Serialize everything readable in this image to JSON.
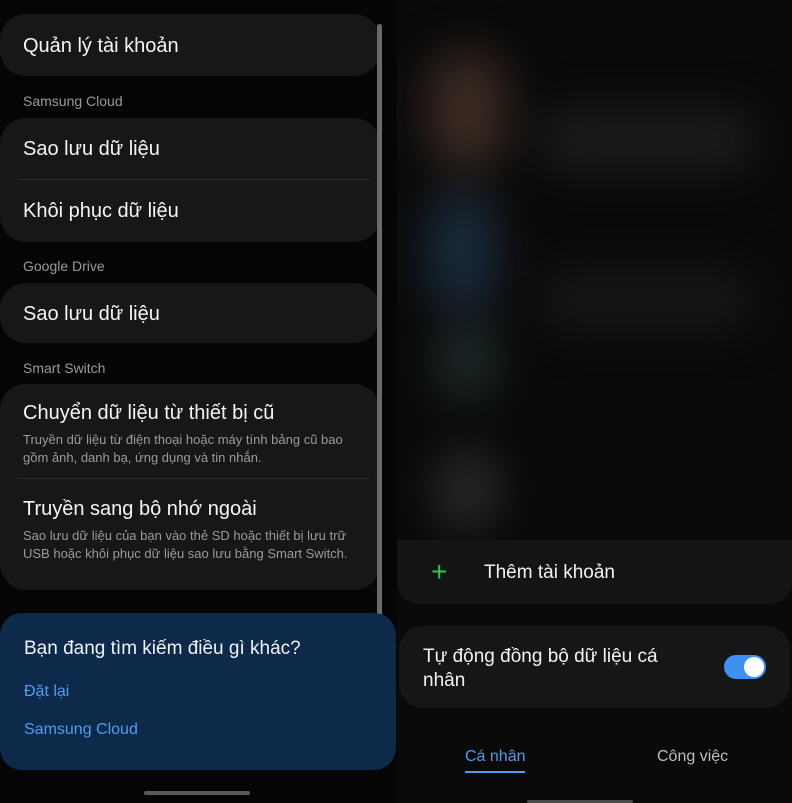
{
  "left": {
    "account_management": "Quản lý tài khoản",
    "sections": {
      "samsung_cloud": "Samsung Cloud",
      "google_drive": "Google Drive",
      "smart_switch": "Smart Switch"
    },
    "samsung_cloud_items": {
      "backup": "Sao lưu dữ liệu",
      "restore": "Khôi phục dữ liệu"
    },
    "google_drive_items": {
      "backup": "Sao lưu dữ liệu"
    },
    "smart_switch_items": {
      "transfer_old": {
        "title": "Chuyển dữ liệu từ thiết bị cũ",
        "subtitle": "Truyền dữ liệu từ điện thoại hoặc máy tính bảng cũ bao gồm ảnh, danh bạ, ứng dụng và tin nhắn."
      },
      "external_storage": {
        "title": "Truyền sang bộ nhớ ngoài",
        "subtitle": "Sao lưu dữ liệu của bạn vào thẻ SD hoặc thiết bị lưu trữ USB hoặc khôi phục dữ liệu sao lưu bằng Smart Switch."
      }
    },
    "search_card": {
      "question": "Bạn đang tìm kiếm điều gì khác?",
      "link_reset": "Đặt lại",
      "link_samsung_cloud": "Samsung Cloud"
    }
  },
  "right": {
    "add_account": "Thêm tài khoản",
    "add_icon": "plus-icon",
    "auto_sync": {
      "label": "Tự động đồng bộ dữ liệu cá nhân",
      "enabled": true
    },
    "tabs": [
      {
        "label": "Cá nhân",
        "active": true
      },
      {
        "label": "Công việc",
        "active": false
      }
    ]
  },
  "colors": {
    "accent": "#4e9cf0",
    "toggle_on": "#3e91f0",
    "plus_green": "#33c14e",
    "search_card_bg": "#0e2a4a"
  }
}
